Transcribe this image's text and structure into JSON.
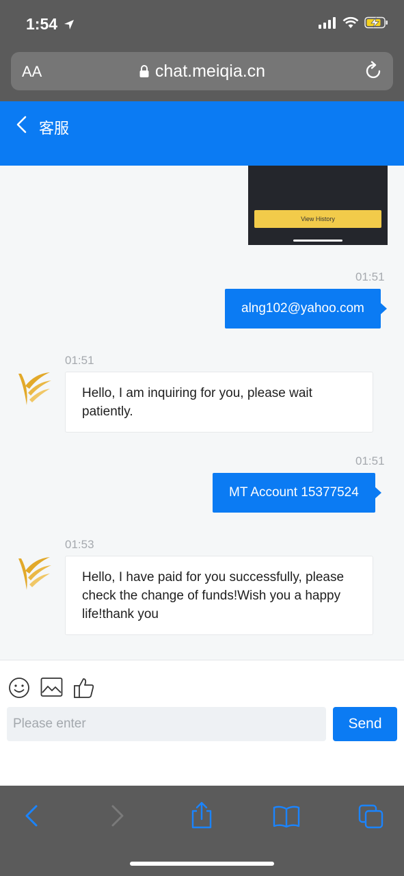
{
  "status_bar": {
    "time": "1:54"
  },
  "browser": {
    "text_size_label": "AA",
    "url": "chat.meiqia.cn"
  },
  "header": {
    "title": "客服"
  },
  "chat": {
    "preview_button": "View History",
    "messages": [
      {
        "from": "user",
        "time": "01:51",
        "text": "alng102@yahoo.com"
      },
      {
        "from": "agent",
        "time": "01:51",
        "text": "Hello, I am inquiring for you, please wait patiently."
      },
      {
        "from": "user",
        "time": "01:51",
        "text": "MT Account 15377524"
      },
      {
        "from": "agent",
        "time": "01:53",
        "text": "Hello, I have paid for you successfully, please check the change of funds!Wish you a happy life!thank you"
      }
    ]
  },
  "composer": {
    "tools": [
      "emoji-icon",
      "image-icon",
      "thumbs-up-icon"
    ],
    "placeholder": "Please enter",
    "value": "",
    "send_label": "Send"
  },
  "toolbar": {
    "icons": [
      "back-icon",
      "forward-icon",
      "share-icon",
      "bookmarks-icon",
      "tabs-icon"
    ]
  },
  "colors": {
    "accent": "#0b7bf3",
    "safari_chrome": "#5b5b5b",
    "avatar_gold": "#e2a92a"
  }
}
